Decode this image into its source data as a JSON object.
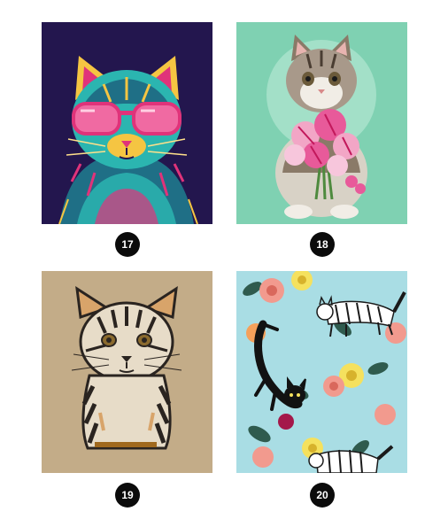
{
  "gallery": {
    "items": [
      {
        "number": "17",
        "icon": "neon-cat-sunglasses-image",
        "colors": {
          "bg": "#23164e",
          "accent": "#e0337a"
        }
      },
      {
        "number": "18",
        "icon": "kitten-with-pink-lilies-image",
        "colors": {
          "bg": "#7fd1b2",
          "accent": "#e85a9a"
        }
      },
      {
        "number": "19",
        "icon": "sketched-cat-on-kraft-paper-image",
        "colors": {
          "bg": "#c7b08e",
          "accent": "#2a2420"
        }
      },
      {
        "number": "20",
        "icon": "cats-and-roses-pattern-image",
        "colors": {
          "bg": "#a9dde4",
          "accent": "#f29a8e"
        }
      }
    ]
  }
}
